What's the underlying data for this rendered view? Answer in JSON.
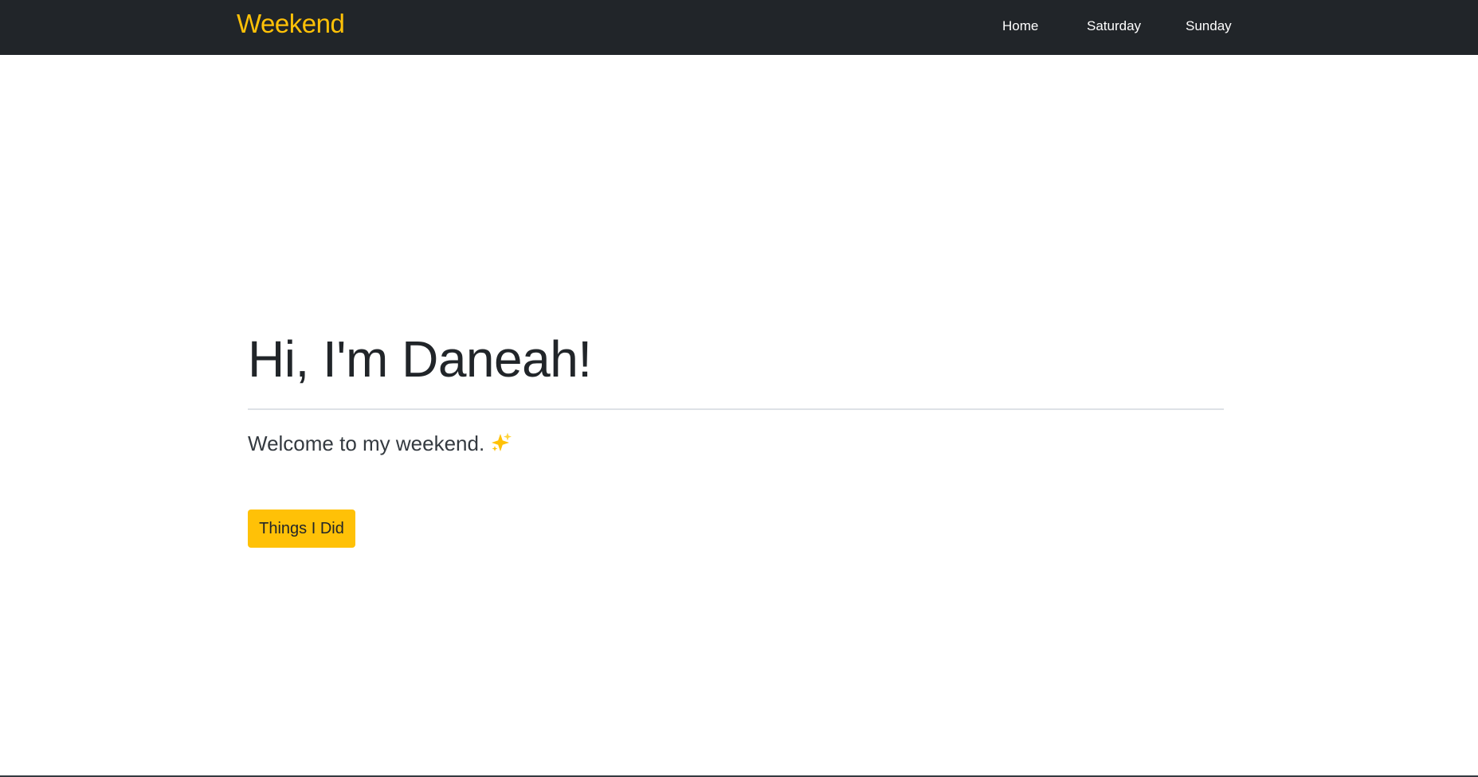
{
  "navbar": {
    "brand": "Weekend",
    "links": [
      {
        "label": "Home"
      },
      {
        "label": "Saturday"
      },
      {
        "label": "Sunday"
      }
    ]
  },
  "hero": {
    "title": "Hi, I'm Daneah!",
    "lead": "Welcome to my weekend.",
    "lead_icon": "sparkles-icon",
    "button_label": "Things I Did"
  },
  "colors": {
    "navbar_background": "#212529",
    "brand": "#ffc107",
    "nav_link": "#ffffff",
    "button_background": "#ffc107",
    "page_background": "#ffffff"
  }
}
